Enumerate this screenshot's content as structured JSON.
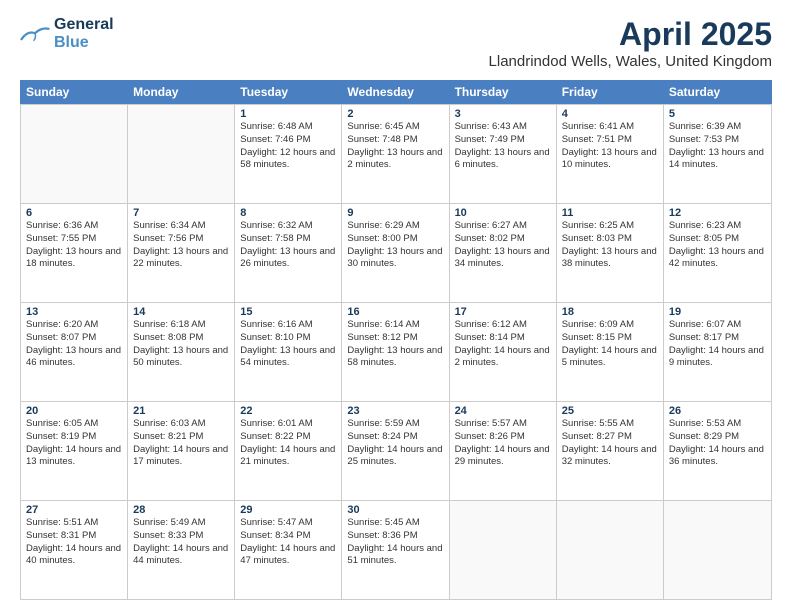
{
  "header": {
    "logo_general": "General",
    "logo_blue": "Blue",
    "month_year": "April 2025",
    "location": "Llandrindod Wells, Wales, United Kingdom"
  },
  "days_of_week": [
    "Sunday",
    "Monday",
    "Tuesday",
    "Wednesday",
    "Thursday",
    "Friday",
    "Saturday"
  ],
  "weeks": [
    [
      {
        "day": "",
        "sunrise": "",
        "sunset": "",
        "daylight": ""
      },
      {
        "day": "",
        "sunrise": "",
        "sunset": "",
        "daylight": ""
      },
      {
        "day": "1",
        "sunrise": "Sunrise: 6:48 AM",
        "sunset": "Sunset: 7:46 PM",
        "daylight": "Daylight: 12 hours and 58 minutes."
      },
      {
        "day": "2",
        "sunrise": "Sunrise: 6:45 AM",
        "sunset": "Sunset: 7:48 PM",
        "daylight": "Daylight: 13 hours and 2 minutes."
      },
      {
        "day": "3",
        "sunrise": "Sunrise: 6:43 AM",
        "sunset": "Sunset: 7:49 PM",
        "daylight": "Daylight: 13 hours and 6 minutes."
      },
      {
        "day": "4",
        "sunrise": "Sunrise: 6:41 AM",
        "sunset": "Sunset: 7:51 PM",
        "daylight": "Daylight: 13 hours and 10 minutes."
      },
      {
        "day": "5",
        "sunrise": "Sunrise: 6:39 AM",
        "sunset": "Sunset: 7:53 PM",
        "daylight": "Daylight: 13 hours and 14 minutes."
      }
    ],
    [
      {
        "day": "6",
        "sunrise": "Sunrise: 6:36 AM",
        "sunset": "Sunset: 7:55 PM",
        "daylight": "Daylight: 13 hours and 18 minutes."
      },
      {
        "day": "7",
        "sunrise": "Sunrise: 6:34 AM",
        "sunset": "Sunset: 7:56 PM",
        "daylight": "Daylight: 13 hours and 22 minutes."
      },
      {
        "day": "8",
        "sunrise": "Sunrise: 6:32 AM",
        "sunset": "Sunset: 7:58 PM",
        "daylight": "Daylight: 13 hours and 26 minutes."
      },
      {
        "day": "9",
        "sunrise": "Sunrise: 6:29 AM",
        "sunset": "Sunset: 8:00 PM",
        "daylight": "Daylight: 13 hours and 30 minutes."
      },
      {
        "day": "10",
        "sunrise": "Sunrise: 6:27 AM",
        "sunset": "Sunset: 8:02 PM",
        "daylight": "Daylight: 13 hours and 34 minutes."
      },
      {
        "day": "11",
        "sunrise": "Sunrise: 6:25 AM",
        "sunset": "Sunset: 8:03 PM",
        "daylight": "Daylight: 13 hours and 38 minutes."
      },
      {
        "day": "12",
        "sunrise": "Sunrise: 6:23 AM",
        "sunset": "Sunset: 8:05 PM",
        "daylight": "Daylight: 13 hours and 42 minutes."
      }
    ],
    [
      {
        "day": "13",
        "sunrise": "Sunrise: 6:20 AM",
        "sunset": "Sunset: 8:07 PM",
        "daylight": "Daylight: 13 hours and 46 minutes."
      },
      {
        "day": "14",
        "sunrise": "Sunrise: 6:18 AM",
        "sunset": "Sunset: 8:08 PM",
        "daylight": "Daylight: 13 hours and 50 minutes."
      },
      {
        "day": "15",
        "sunrise": "Sunrise: 6:16 AM",
        "sunset": "Sunset: 8:10 PM",
        "daylight": "Daylight: 13 hours and 54 minutes."
      },
      {
        "day": "16",
        "sunrise": "Sunrise: 6:14 AM",
        "sunset": "Sunset: 8:12 PM",
        "daylight": "Daylight: 13 hours and 58 minutes."
      },
      {
        "day": "17",
        "sunrise": "Sunrise: 6:12 AM",
        "sunset": "Sunset: 8:14 PM",
        "daylight": "Daylight: 14 hours and 2 minutes."
      },
      {
        "day": "18",
        "sunrise": "Sunrise: 6:09 AM",
        "sunset": "Sunset: 8:15 PM",
        "daylight": "Daylight: 14 hours and 5 minutes."
      },
      {
        "day": "19",
        "sunrise": "Sunrise: 6:07 AM",
        "sunset": "Sunset: 8:17 PM",
        "daylight": "Daylight: 14 hours and 9 minutes."
      }
    ],
    [
      {
        "day": "20",
        "sunrise": "Sunrise: 6:05 AM",
        "sunset": "Sunset: 8:19 PM",
        "daylight": "Daylight: 14 hours and 13 minutes."
      },
      {
        "day": "21",
        "sunrise": "Sunrise: 6:03 AM",
        "sunset": "Sunset: 8:21 PM",
        "daylight": "Daylight: 14 hours and 17 minutes."
      },
      {
        "day": "22",
        "sunrise": "Sunrise: 6:01 AM",
        "sunset": "Sunset: 8:22 PM",
        "daylight": "Daylight: 14 hours and 21 minutes."
      },
      {
        "day": "23",
        "sunrise": "Sunrise: 5:59 AM",
        "sunset": "Sunset: 8:24 PM",
        "daylight": "Daylight: 14 hours and 25 minutes."
      },
      {
        "day": "24",
        "sunrise": "Sunrise: 5:57 AM",
        "sunset": "Sunset: 8:26 PM",
        "daylight": "Daylight: 14 hours and 29 minutes."
      },
      {
        "day": "25",
        "sunrise": "Sunrise: 5:55 AM",
        "sunset": "Sunset: 8:27 PM",
        "daylight": "Daylight: 14 hours and 32 minutes."
      },
      {
        "day": "26",
        "sunrise": "Sunrise: 5:53 AM",
        "sunset": "Sunset: 8:29 PM",
        "daylight": "Daylight: 14 hours and 36 minutes."
      }
    ],
    [
      {
        "day": "27",
        "sunrise": "Sunrise: 5:51 AM",
        "sunset": "Sunset: 8:31 PM",
        "daylight": "Daylight: 14 hours and 40 minutes."
      },
      {
        "day": "28",
        "sunrise": "Sunrise: 5:49 AM",
        "sunset": "Sunset: 8:33 PM",
        "daylight": "Daylight: 14 hours and 44 minutes."
      },
      {
        "day": "29",
        "sunrise": "Sunrise: 5:47 AM",
        "sunset": "Sunset: 8:34 PM",
        "daylight": "Daylight: 14 hours and 47 minutes."
      },
      {
        "day": "30",
        "sunrise": "Sunrise: 5:45 AM",
        "sunset": "Sunset: 8:36 PM",
        "daylight": "Daylight: 14 hours and 51 minutes."
      },
      {
        "day": "",
        "sunrise": "",
        "sunset": "",
        "daylight": ""
      },
      {
        "day": "",
        "sunrise": "",
        "sunset": "",
        "daylight": ""
      },
      {
        "day": "",
        "sunrise": "",
        "sunset": "",
        "daylight": ""
      }
    ]
  ]
}
